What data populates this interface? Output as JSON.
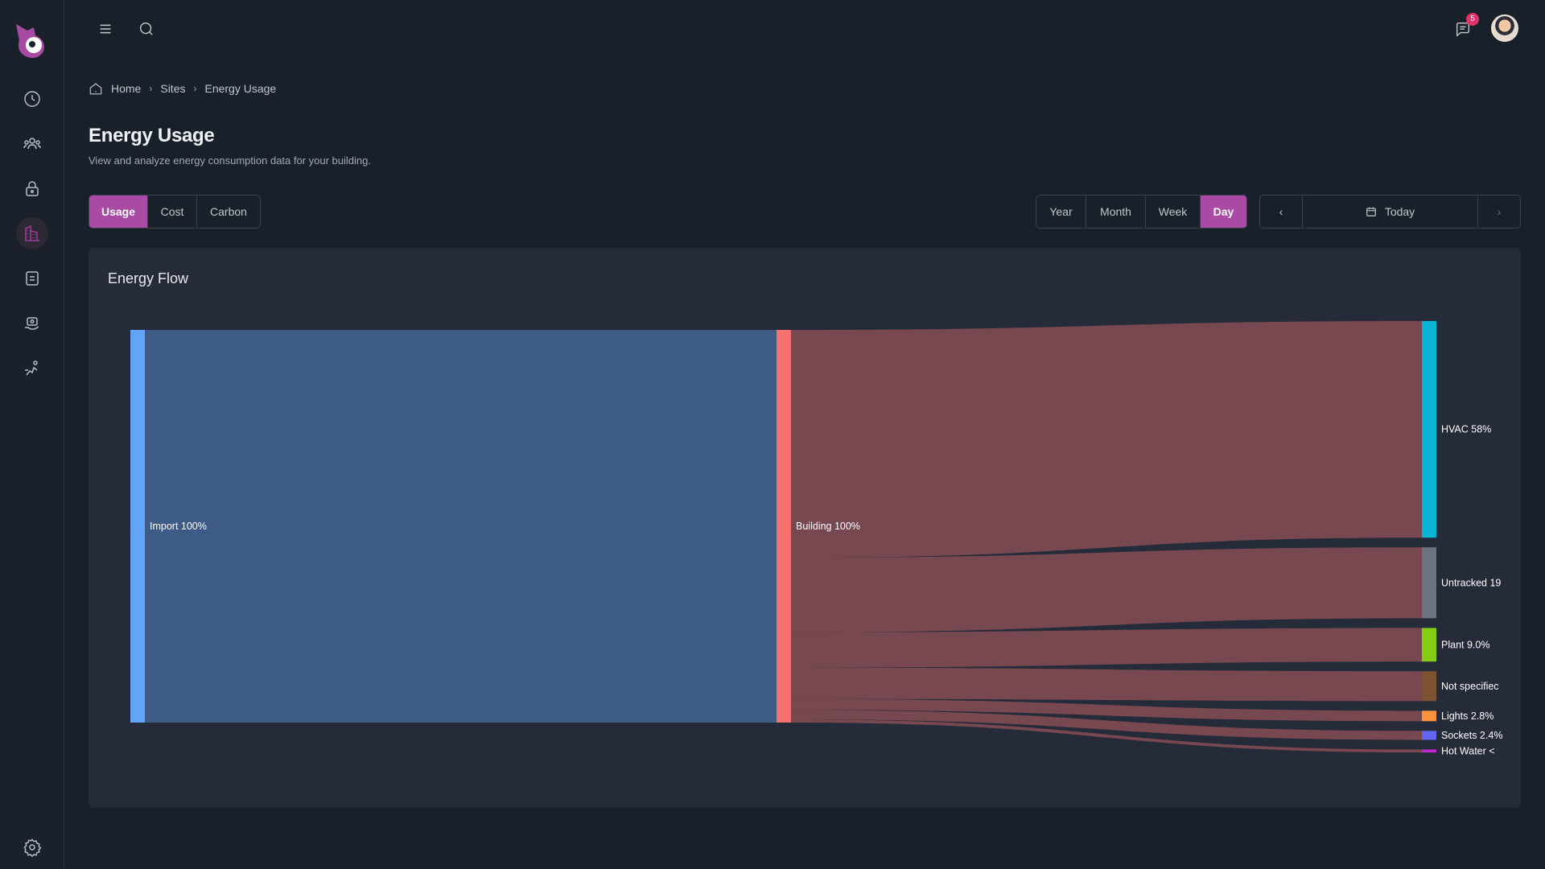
{
  "sidebar": {
    "icons": [
      "clock-icon",
      "users-icon",
      "lock-icon",
      "buildings-icon",
      "document-icon",
      "support-icon",
      "activity-icon"
    ],
    "active": "buildings-icon",
    "settings": "gear-icon"
  },
  "topbar": {
    "notifications_count": "5"
  },
  "breadcrumb": {
    "home": "Home",
    "sites": "Sites",
    "current": "Energy Usage"
  },
  "page": {
    "title": "Energy Usage",
    "subtitle": "View and analyze energy consumption data for your building."
  },
  "metric_tabs": [
    {
      "label": "Usage",
      "active": true
    },
    {
      "label": "Cost",
      "active": false
    },
    {
      "label": "Carbon",
      "active": false
    }
  ],
  "period_tabs": [
    {
      "label": "Year",
      "active": false
    },
    {
      "label": "Month",
      "active": false
    },
    {
      "label": "Week",
      "active": false
    },
    {
      "label": "Day",
      "active": true
    }
  ],
  "date_nav": {
    "label": "Today"
  },
  "panel": {
    "title": "Energy Flow"
  },
  "chart_data": {
    "type": "sankey",
    "nodes": [
      {
        "id": "import",
        "label": "Import 100%",
        "value": 100,
        "color": "#60a5fa"
      },
      {
        "id": "building",
        "label": "Building 100%",
        "value": 100,
        "color": "#f87171"
      },
      {
        "id": "hvac",
        "label": "HVAC 58%",
        "value": 58,
        "color": "#06b6d4"
      },
      {
        "id": "untracked",
        "label": "Untracked 19",
        "value": 19,
        "color": "#6b7280"
      },
      {
        "id": "plant",
        "label": "Plant 9.0%",
        "value": 9,
        "color": "#84cc16"
      },
      {
        "id": "notspecified",
        "label": "Not specifiec",
        "value": 8,
        "color": "#7c5230"
      },
      {
        "id": "lights",
        "label": "Lights 2.8%",
        "value": 2.8,
        "color": "#fb923c"
      },
      {
        "id": "sockets",
        "label": "Sockets 2.4%",
        "value": 2.4,
        "color": "#6366f1"
      },
      {
        "id": "hotwater",
        "label": "Hot Water <",
        "value": 0.8,
        "color": "#c026d3"
      }
    ],
    "links": [
      {
        "source": "import",
        "target": "building",
        "value": 100
      },
      {
        "source": "building",
        "target": "hvac",
        "value": 58
      },
      {
        "source": "building",
        "target": "untracked",
        "value": 19
      },
      {
        "source": "building",
        "target": "plant",
        "value": 9
      },
      {
        "source": "building",
        "target": "notspecified",
        "value": 8
      },
      {
        "source": "building",
        "target": "lights",
        "value": 2.8
      },
      {
        "source": "building",
        "target": "sockets",
        "value": 2.4
      },
      {
        "source": "building",
        "target": "hotwater",
        "value": 0.8
      }
    ],
    "link_colors": {
      "import": "#3f5d8a",
      "building": "#7c4a52"
    }
  }
}
